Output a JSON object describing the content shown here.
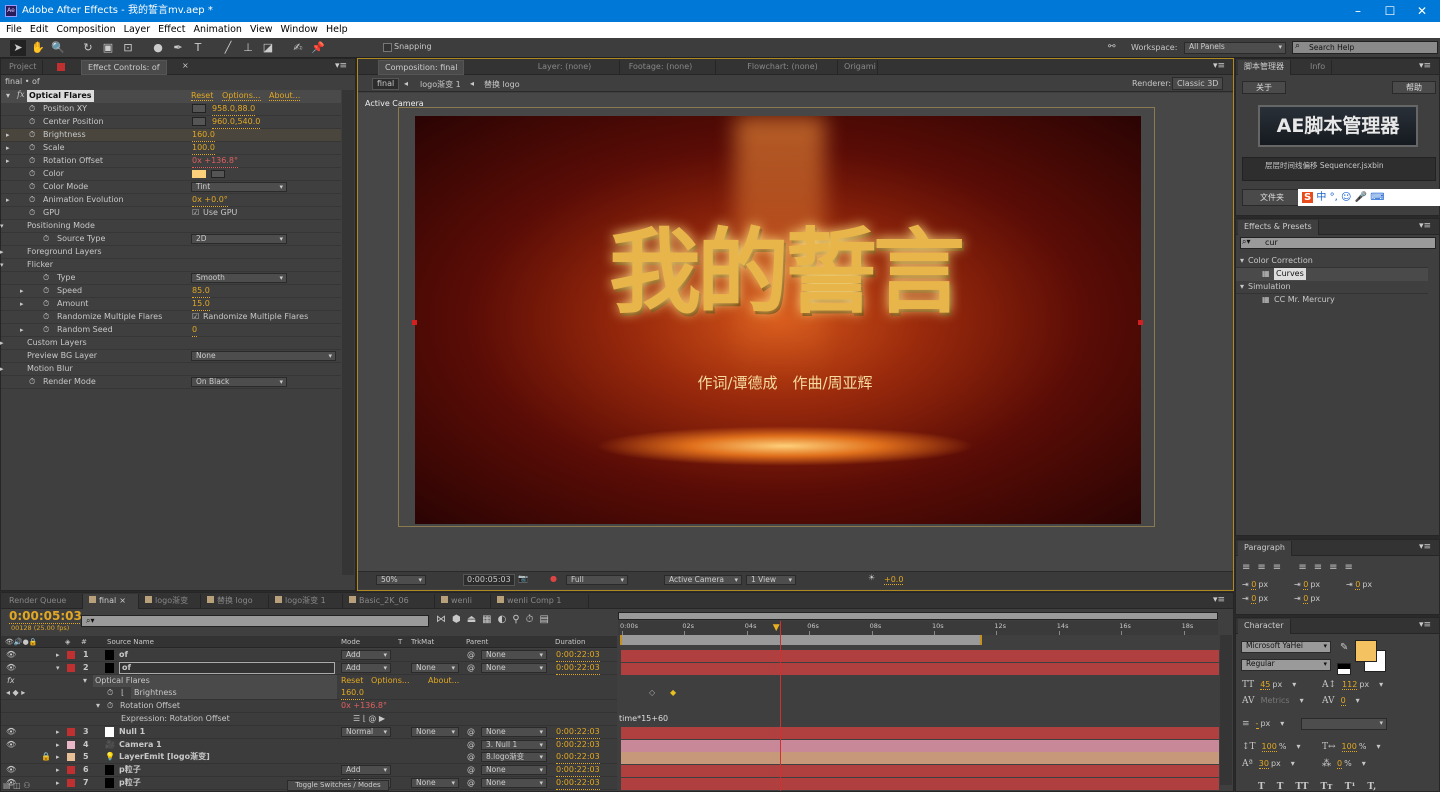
{
  "window": {
    "title": "Adobe After Effects - 我的誓言mv.aep *",
    "app_icon": "Ae",
    "controls": [
      "–",
      "☐",
      "✕"
    ]
  },
  "menu": [
    "File",
    "Edit",
    "Composition",
    "Layer",
    "Effect",
    "Animation",
    "View",
    "Window",
    "Help"
  ],
  "toolbar": {
    "tools": [
      "selection-icon",
      "hand-icon",
      "zoom-icon",
      "rotate-icon",
      "camera-icon",
      "pan-behind-icon",
      "ellipse-icon",
      "pen-icon",
      "type-icon",
      "brush-icon",
      "clone-stamp-icon",
      "eraser-icon",
      "roto-brush-icon",
      "puppet-pin-icon"
    ],
    "snapping": "Snapping",
    "workspace_label": "Workspace:",
    "workspace_value": "All Panels",
    "search_placeholder": "Search Help"
  },
  "effect_controls": {
    "tabs": [
      "Project",
      "Effect Controls: of"
    ],
    "breadcrumb": "final • of",
    "effect_name": "Optical Flares",
    "links": [
      "Reset",
      "Options...",
      "About..."
    ],
    "rows": [
      {
        "label": "Position XY",
        "indent": 1,
        "twirl": false,
        "value": "958.0,88.0",
        "type": "point"
      },
      {
        "label": "Center Position",
        "indent": 1,
        "twirl": false,
        "value": "960.0,540.0",
        "type": "point"
      },
      {
        "label": "Brightness",
        "indent": 1,
        "twirl": true,
        "value": "160.0",
        "type": "num",
        "selected": true
      },
      {
        "label": "Scale",
        "indent": 1,
        "twirl": true,
        "value": "100.0",
        "type": "num"
      },
      {
        "label": "Rotation Offset",
        "indent": 1,
        "twirl": true,
        "value": "0x +136.8°",
        "type": "red"
      },
      {
        "label": "Color",
        "indent": 1,
        "twirl": false,
        "value": "",
        "type": "color"
      },
      {
        "label": "Color Mode",
        "indent": 1,
        "twirl": false,
        "value": "Tint",
        "type": "dd"
      },
      {
        "label": "Animation Evolution",
        "indent": 1,
        "twirl": true,
        "value": "0x +0.0°",
        "type": "num"
      },
      {
        "label": "GPU",
        "indent": 1,
        "twirl": false,
        "value": "Use GPU",
        "type": "check"
      },
      {
        "label": "Positioning Mode",
        "indent": 0,
        "twirl": true,
        "open": true,
        "value": "",
        "type": "group"
      },
      {
        "label": "Source Type",
        "indent": 2,
        "twirl": false,
        "value": "2D",
        "type": "dd"
      },
      {
        "label": "Foreground Layers",
        "indent": 0,
        "twirl": true,
        "value": "",
        "type": "group"
      },
      {
        "label": "Flicker",
        "indent": 0,
        "twirl": true,
        "open": true,
        "value": "",
        "type": "group"
      },
      {
        "label": "Type",
        "indent": 2,
        "twirl": false,
        "value": "Smooth",
        "type": "dd"
      },
      {
        "label": "Speed",
        "indent": 2,
        "twirl": true,
        "value": "85.0",
        "type": "num"
      },
      {
        "label": "Amount",
        "indent": 2,
        "twirl": true,
        "value": "15.0",
        "type": "num"
      },
      {
        "label": "Randomize Multiple Flares",
        "indent": 2,
        "twirl": false,
        "value": "Randomize Multiple Flares",
        "type": "check"
      },
      {
        "label": "Random Seed",
        "indent": 2,
        "twirl": true,
        "value": "0",
        "type": "num"
      },
      {
        "label": "Custom Layers",
        "indent": 0,
        "twirl": true,
        "value": "",
        "type": "group"
      },
      {
        "label": "Preview BG Layer",
        "indent": 0,
        "twirl": false,
        "value": "None",
        "type": "ddwide"
      },
      {
        "label": "Motion Blur",
        "indent": 0,
        "twirl": true,
        "value": "",
        "type": "group"
      },
      {
        "label": "Render Mode",
        "indent": 1,
        "twirl": false,
        "value": "On Black",
        "type": "dd"
      }
    ],
    "flare_color": "#fccf7a"
  },
  "composition": {
    "tabs": [
      "Composition: final",
      "Layer: (none)",
      "Footage: (none)",
      "Flowchart: (none)",
      "Origami"
    ],
    "breadcrumbs": [
      "final",
      "logo渐变 1",
      "替换 logo"
    ],
    "renderer_label": "Renderer:",
    "renderer_value": "Classic 3D",
    "view_label": "Active Camera",
    "title_art": "我的誓言",
    "credits": "作词/谭德成　作曲/周亚辉",
    "footer": {
      "zoom": "50%",
      "timecode": "0:00:05:03",
      "resolution": "Full",
      "camera": "Active Camera",
      "views": "1 View",
      "exposure": "+0.0"
    }
  },
  "script_manager": {
    "tabs": [
      "脚本管理器",
      "Info"
    ],
    "about": "关于",
    "help": "帮助",
    "logo": "AE脚本管理器",
    "list_item": "层层时间线偏移 Sequencer.jsxbin",
    "folder": "文件夹",
    "ime": [
      "中",
      "°,",
      "☺",
      "🎤",
      "⌨"
    ]
  },
  "effects_presets": {
    "tab": "Effects & Presets",
    "search": "cur",
    "groups": [
      {
        "name": "Color Correction",
        "items": [
          "Curves"
        ]
      },
      {
        "name": "Simulation",
        "items": [
          "CC Mr. Mercury"
        ]
      }
    ]
  },
  "paragraph": {
    "tab": "Paragraph",
    "fields": [
      "0",
      "0",
      "0",
      "0",
      "0"
    ],
    "unit": "px"
  },
  "character": {
    "tab": "Character",
    "font": "Microsoft YaHei",
    "style": "Regular",
    "size": "45",
    "leading": "112",
    "kerning": "Metrics",
    "tracking": "0",
    "stroke": "-",
    "vscale": "100",
    "hscale": "100",
    "baseline": "30",
    "tsume": "0",
    "fill_color": "#f5c262",
    "styles": [
      "T",
      "T",
      "TT",
      "Tт",
      "T¹",
      "T,"
    ]
  },
  "timeline": {
    "tabs": [
      "Render Queue",
      "final",
      "logo渐变",
      "替换 logo",
      "logo渐变 1",
      "Basic_2K_06",
      "wenli",
      "wenli Comp 1"
    ],
    "timecode": "0:00:05:03",
    "frames": "00128 (25.00 fps)",
    "columns": [
      "#",
      "Source Name",
      "Mode",
      "T",
      "TrkMat",
      "Parent",
      "Duration"
    ],
    "ruler": [
      "0:00s",
      "02s",
      "04s",
      "06s",
      "08s",
      "10s",
      "12s",
      "14s",
      "16s",
      "18s"
    ],
    "current_time_s": 5.12,
    "work_area_end_s": 11.6,
    "layers": [
      {
        "num": "1",
        "name": "of",
        "label_color": "#c03030",
        "swatch": "#000",
        "mode": "Add",
        "trkmat": "",
        "parent": "None",
        "duration": "0:00:22:03"
      },
      {
        "num": "2",
        "name": "of",
        "label_color": "#c03030",
        "swatch": "#000",
        "mode": "Add",
        "trkmat": "None",
        "parent": "None",
        "duration": "0:00:22:03",
        "open": true
      },
      {
        "num": "3",
        "name": "Null 1",
        "label_color": "#c03030",
        "swatch": "#fff",
        "mode": "Normal",
        "trkmat": "None",
        "parent": "None",
        "duration": "0:00:22:03"
      },
      {
        "num": "4",
        "name": "Camera 1",
        "label_color": "#e8b8c8",
        "swatch": "",
        "mode": "",
        "trkmat": "",
        "parent": "3. Null 1",
        "duration": "0:00:22:03"
      },
      {
        "num": "5",
        "name": "LayerEmit [logo渐变]",
        "label_color": "#e8c098",
        "swatch": "",
        "mode": "",
        "trkmat": "",
        "parent": "8.logo渐变",
        "duration": "0:00:22:03"
      },
      {
        "num": "6",
        "name": "p粒子",
        "label_color": "#c03030",
        "swatch": "#000",
        "mode": "Add",
        "trkmat": "",
        "parent": "None",
        "duration": "0:00:22:03"
      },
      {
        "num": "7",
        "name": "p粒子",
        "label_color": "#c03030",
        "swatch": "#000",
        "mode": "Add",
        "trkmat": "None",
        "parent": "None",
        "duration": "0:00:22:03"
      }
    ],
    "sub": {
      "effect": "Optical Flares",
      "links": [
        "Reset",
        "Options...",
        "About..."
      ],
      "brightness_label": "Brightness",
      "brightness": "160.0",
      "rotation_label": "Rotation Offset",
      "rotation": "0x +136.8°",
      "expr_label": "Expression: Rotation Offset",
      "expression": "time*15+60"
    },
    "bar_colors": [
      "#b04040",
      "#b04040",
      "#b04040",
      "#c88898",
      "#c8987a",
      "#b04040",
      "#b04040"
    ],
    "toggle": "Toggle Switches / Modes"
  }
}
